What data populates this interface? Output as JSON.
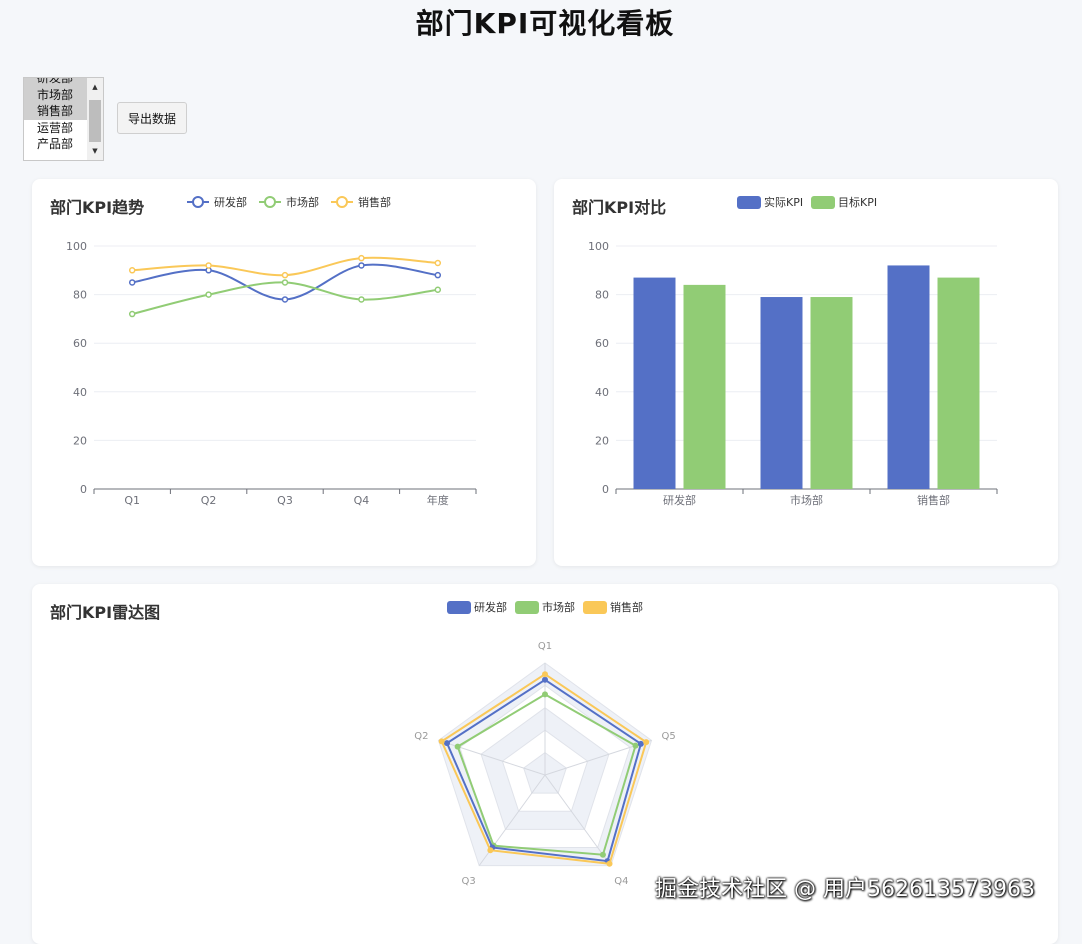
{
  "page_title": "部门KPI可视化看板",
  "department_select": {
    "options": [
      "研发部",
      "市场部",
      "销售部",
      "运营部",
      "产品部"
    ],
    "selected": [
      "研发部",
      "市场部",
      "销售部"
    ]
  },
  "export_button_label": "导出数据",
  "colors": {
    "rd": "#5470c6",
    "marketing": "#91cc75",
    "sales": "#fac858"
  },
  "trend_card": {
    "title": "部门KPI趋势"
  },
  "compare_card": {
    "title": "部门KPI对比"
  },
  "radar_card": {
    "title": "部门KPI雷达图"
  },
  "watermark": "掘金技术社区 @ 用户562613573963",
  "chart_data": [
    {
      "type": "line",
      "title": "部门KPI趋势",
      "categories": [
        "Q1",
        "Q2",
        "Q3",
        "Q4",
        "年度"
      ],
      "ylim": [
        0,
        100
      ],
      "yticks": [
        0,
        20,
        40,
        60,
        80,
        100
      ],
      "smooth": true,
      "legend": "top",
      "series": [
        {
          "name": "研发部",
          "values": [
            85,
            90,
            78,
            92,
            88
          ]
        },
        {
          "name": "市场部",
          "values": [
            72,
            80,
            85,
            78,
            82
          ]
        },
        {
          "name": "销售部",
          "values": [
            90,
            92,
            88,
            95,
            93
          ]
        }
      ]
    },
    {
      "type": "bar",
      "title": "部门KPI对比",
      "categories": [
        "研发部",
        "市场部",
        "销售部"
      ],
      "ylim": [
        0,
        100
      ],
      "yticks": [
        0,
        20,
        40,
        60,
        80,
        100
      ],
      "legend": "top",
      "series": [
        {
          "name": "实际KPI",
          "values": [
            87,
            79,
            92
          ]
        },
        {
          "name": "目标KPI",
          "values": [
            84,
            79,
            87
          ]
        }
      ]
    },
    {
      "type": "radar",
      "title": "部门KPI雷达图",
      "indicators": [
        "Q1",
        "Q5",
        "Q4",
        "Q3",
        "Q2"
      ],
      "max": 100,
      "legend": "top",
      "series": [
        {
          "name": "研发部",
          "values": [
            85,
            90,
            95,
            80,
            92
          ]
        },
        {
          "name": "市场部",
          "values": [
            72,
            85,
            88,
            78,
            82
          ]
        },
        {
          "name": "销售部",
          "values": [
            90,
            95,
            98,
            83,
            97
          ]
        }
      ]
    }
  ]
}
